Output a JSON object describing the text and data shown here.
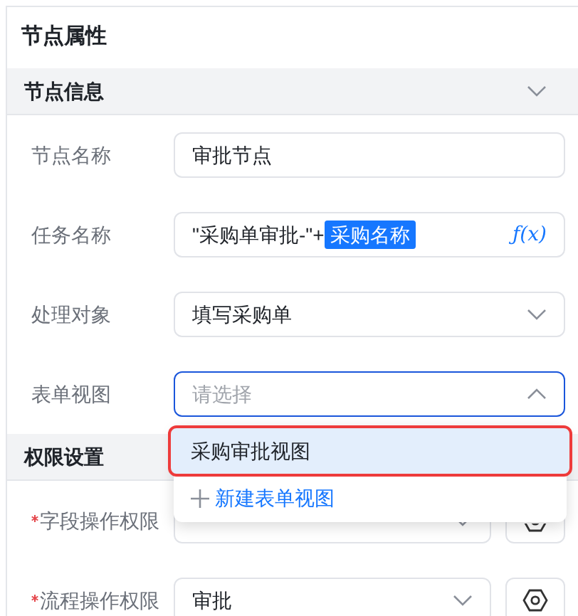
{
  "panel": {
    "title": "节点属性"
  },
  "sections": [
    {
      "title": "节点信息",
      "expanded": true,
      "fields": [
        {
          "kind": "input",
          "label": "节点名称",
          "value": "审批节点"
        },
        {
          "kind": "formula",
          "label": "任务名称",
          "prefix": "\"采购单审批-\"+",
          "tag": "采购名称",
          "icon_text": "ƒ(x)"
        },
        {
          "kind": "select",
          "label": "处理对象",
          "value": "填写采购单",
          "open": false
        },
        {
          "kind": "select",
          "label": "表单视图",
          "placeholder": "请选择",
          "open": true,
          "options": [
            {
              "label": "采购审批视图",
              "highlighted": true
            }
          ],
          "action": "新建表单视图"
        }
      ]
    },
    {
      "title": "权限设置",
      "fields": [
        {
          "kind": "select_gear",
          "label": "字段操作权限",
          "required": true
        },
        {
          "kind": "select_gear",
          "label": "流程操作权限",
          "required": true,
          "value": "审批"
        }
      ]
    }
  ]
}
